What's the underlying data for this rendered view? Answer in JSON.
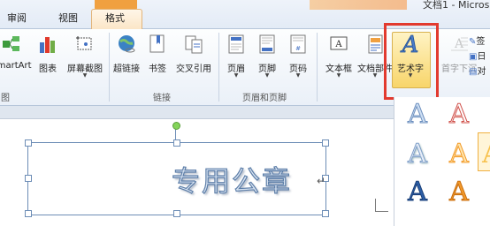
{
  "title_bar": {
    "text": "文档1 - Micros"
  },
  "tabs": [
    {
      "label": "审阅"
    },
    {
      "label": "视图"
    },
    {
      "label": "格式"
    }
  ],
  "ribbon": {
    "buttons": [
      {
        "label": "SmartArt",
        "icon": "smartart-icon"
      },
      {
        "label": "图表",
        "icon": "chart-icon"
      },
      {
        "label": "屏幕截图",
        "icon": "screenshot-icon"
      },
      {
        "label": "超链接",
        "icon": "hyperlink-icon"
      },
      {
        "label": "书签",
        "icon": "bookmark-icon"
      },
      {
        "label": "交叉引用",
        "icon": "cross-reference-icon"
      },
      {
        "label": "页眉",
        "icon": "header-icon"
      },
      {
        "label": "页脚",
        "icon": "footer-icon"
      },
      {
        "label": "页码",
        "icon": "page-number-icon"
      },
      {
        "label": "文本框",
        "icon": "textbox-icon"
      },
      {
        "label": "文档部件",
        "icon": "quick-parts-icon"
      },
      {
        "label": "艺术字",
        "icon": "wordart-icon"
      },
      {
        "label": "首字下沉",
        "icon": "drop-cap-icon"
      }
    ],
    "groups": [
      {
        "label": "图"
      },
      {
        "label": "链接"
      },
      {
        "label": "页眉和页脚"
      }
    ],
    "side_items": [
      {
        "label": "签"
      },
      {
        "label": "日"
      },
      {
        "label": "对"
      }
    ]
  },
  "document": {
    "wordart_text": "专用公章"
  },
  "colors": {
    "highlight": "#e23a2f",
    "accent": "#f0a040",
    "wordart_fill": "#d9e4f2",
    "wordart_outline": "#5d7ea8"
  }
}
